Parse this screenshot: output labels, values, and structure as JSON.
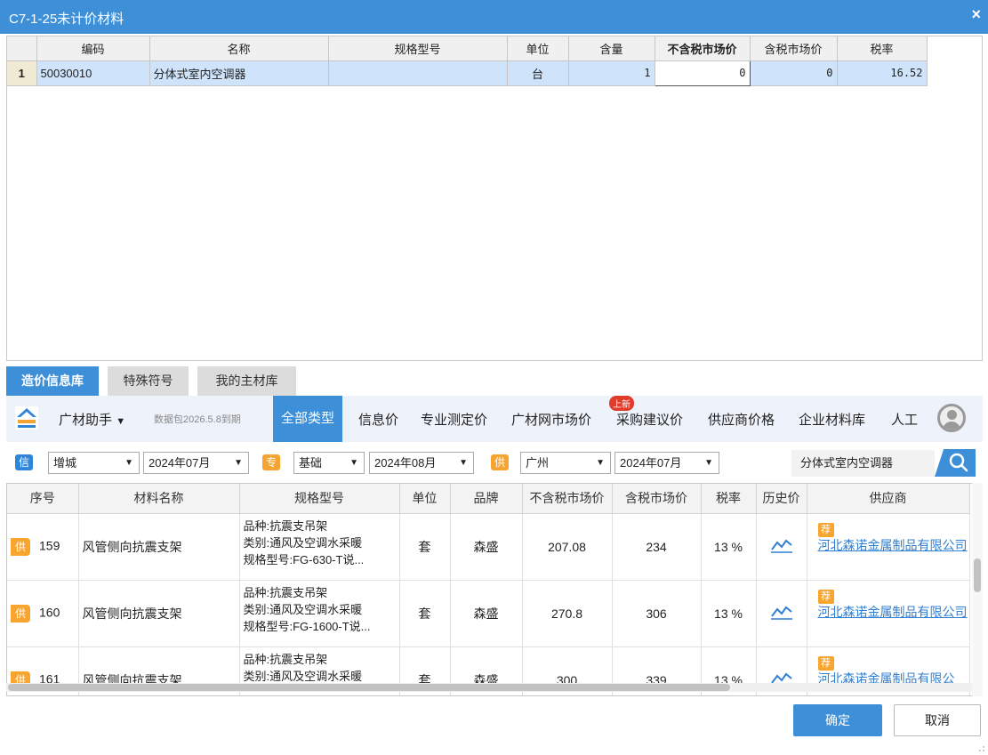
{
  "window": {
    "title": "C7-1-25未计价材料",
    "close_glyph": "×"
  },
  "upper_grid": {
    "columns": [
      "编码",
      "名称",
      "规格型号",
      "单位",
      "含量",
      "不含税市场价",
      "含税市场价",
      "税率"
    ],
    "rows": [
      {
        "row_no": "1",
        "code": "50030010",
        "name": "分体式室内空调器",
        "spec": "",
        "unit": "台",
        "qty": "1",
        "price_ex_tax": "0",
        "price_in_tax": "0",
        "tax_rate": "16.52"
      }
    ]
  },
  "tabs": [
    "造价信息库",
    "特殊符号",
    "我的主材库"
  ],
  "toolbar": {
    "brand": "广材助手",
    "brand_arrow": "▼",
    "expiry": "数据包2026.5.8到期",
    "categories": [
      "全部类型",
      "信息价",
      "专业测定价",
      "广材网市场价",
      "采购建议价",
      "供应商价格",
      "企业材料库",
      "人工"
    ],
    "new_badge": "上新"
  },
  "filters": {
    "xin": {
      "tag": "信",
      "region": "增城",
      "date": "2024年07月",
      "color": "#2f86d9"
    },
    "zhuan": {
      "tag": "专",
      "type": "基础",
      "date": "2024年08月",
      "color": "#f5a331"
    },
    "gong": {
      "tag": "供",
      "region": "广州",
      "date": "2024年07月",
      "color": "#f5a331"
    },
    "search_text": "分体式室内空调器"
  },
  "lower_grid": {
    "columns": [
      "序号",
      "材料名称",
      "规格型号",
      "单位",
      "品牌",
      "不含税市场价",
      "含税市场价",
      "税率",
      "历史价",
      "供应商"
    ],
    "rows": [
      {
        "tag": "供",
        "no": "159",
        "name": "风管侧向抗震支架",
        "spec": "品种:抗震支吊架\n类别:通风及空调水采暖\n规格型号:FG-630-T说...",
        "unit": "套",
        "brand": "森盛",
        "price_ex_tax": "207.08",
        "price_in_tax": "234",
        "tax_rate": "13 %",
        "rec": "荐",
        "supplier": "河北森诺金属制品有限公司"
      },
      {
        "tag": "供",
        "no": "160",
        "name": "风管侧向抗震支架",
        "spec": "品种:抗震支吊架\n类别:通风及空调水采暖\n规格型号:FG-1600-T说...",
        "unit": "套",
        "brand": "森盛",
        "price_ex_tax": "270.8",
        "price_in_tax": "306",
        "tax_rate": "13 %",
        "rec": "荐",
        "supplier": "河北森诺金属制品有限公司"
      },
      {
        "tag": "供",
        "no": "161",
        "name": "风管侧向抗震支架",
        "spec": "品种:抗震支吊架\n类别:通风及空调水采暖",
        "unit": "套",
        "brand": "森盛",
        "price_ex_tax": "300",
        "price_in_tax": "339",
        "tax_rate": "13 %",
        "rec": "荐",
        "supplier": "河北森诺金属制品有限公"
      }
    ]
  },
  "buttons": {
    "ok": "确定",
    "cancel": "取消"
  },
  "colors": {
    "accent": "#3d8fd8",
    "orange": "#f7a52f",
    "link": "#2f7fd2",
    "selected_row": "#cfe4fb"
  },
  "icons": {
    "history": "chart-line-icon",
    "search": "search-icon",
    "avatar": "user-avatar-icon",
    "logo": "gc-logo-icon"
  }
}
